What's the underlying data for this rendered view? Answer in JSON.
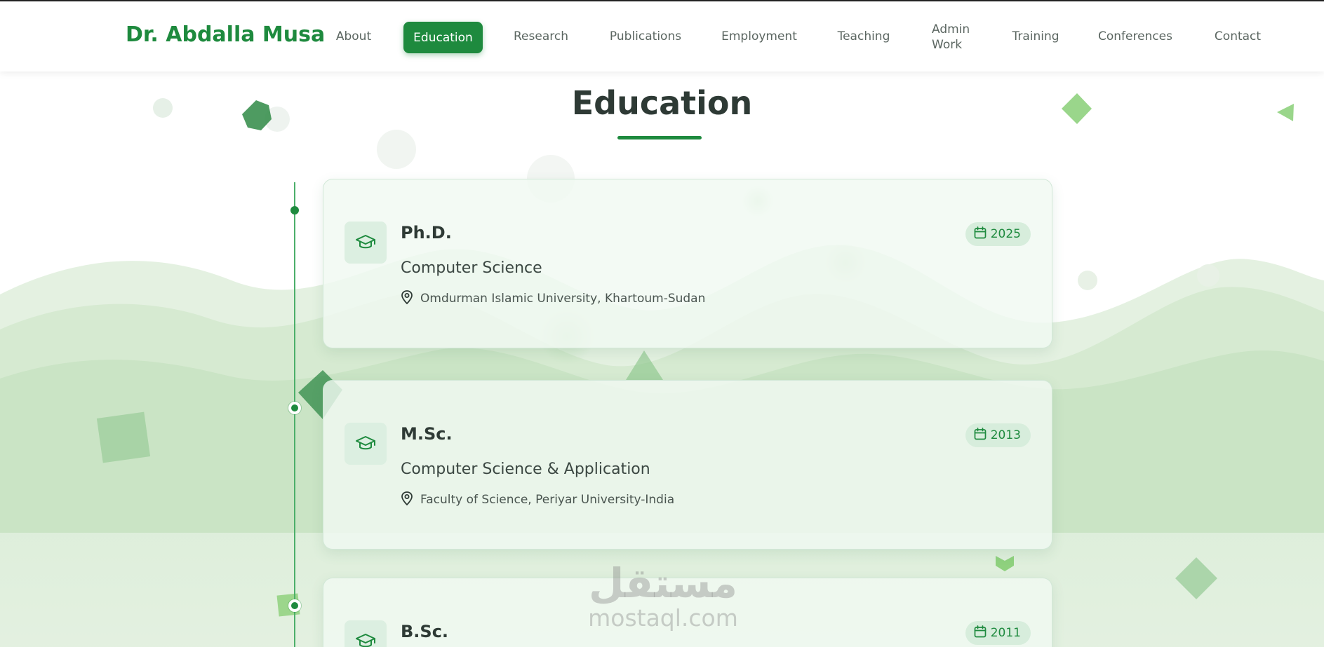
{
  "header": {
    "brand": "Dr. Abdalla Musa",
    "nav": [
      {
        "label": "About",
        "active": false
      },
      {
        "label": "Education",
        "active": true
      },
      {
        "label": "Research",
        "active": false
      },
      {
        "label": "Publications",
        "active": false
      },
      {
        "label": "Employment",
        "active": false
      },
      {
        "label": "Teaching",
        "active": false
      },
      {
        "label": "Admin Work",
        "active": false
      },
      {
        "label": "Training",
        "active": false
      },
      {
        "label": "Conferences",
        "active": false
      },
      {
        "label": "Contact",
        "active": false
      }
    ]
  },
  "section": {
    "title": "Education"
  },
  "education": [
    {
      "degree": "Ph.D.",
      "field": "Computer Science",
      "institution": "Omdurman Islamic University, Khartoum-Sudan",
      "year": "2025",
      "icon": "graduation-cap-icon"
    },
    {
      "degree": "M.Sc.",
      "field": "Computer Science & Application",
      "institution": "Faculty of Science, Periyar University-India",
      "year": "2013",
      "icon": "graduation-cap-icon"
    },
    {
      "degree": "B.Sc.",
      "year": "2011",
      "icon": "graduation-cap-icon"
    }
  ],
  "watermark": {
    "arabic": "مستقل",
    "latin": "mostaql.com"
  },
  "colors": {
    "accent": "#1e8a3e",
    "badge_bg": "#d7eddc",
    "card_bg": "#f0f9f2",
    "text_dark": "#2e3a35"
  }
}
